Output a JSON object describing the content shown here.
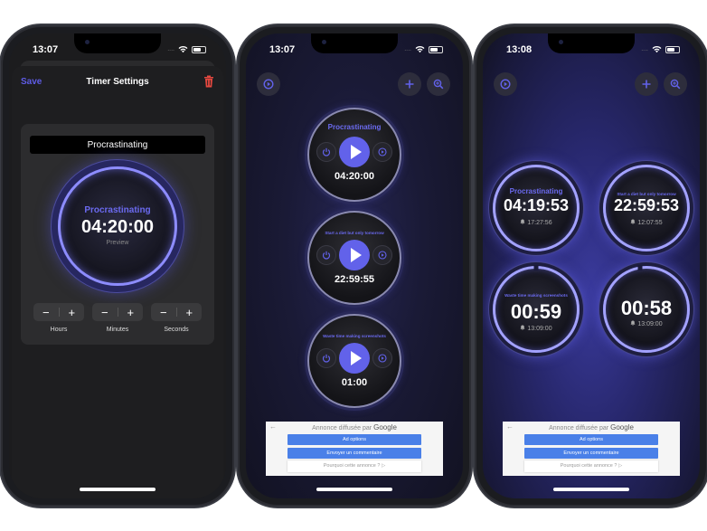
{
  "phones": [
    {
      "status": {
        "time": "13:07",
        "signal": "....",
        "icons": [
          "wifi-icon",
          "battery-icon"
        ]
      },
      "header": {
        "save_label": "Save",
        "title": "Timer Settings",
        "delete_icon": "trash-icon"
      },
      "name_field": {
        "value": "Procrastinating"
      },
      "preview": {
        "label": "Procrastinating",
        "time": "04:20:00",
        "caption": "Preview"
      },
      "steppers": [
        {
          "label": "Hours",
          "minus": "−",
          "plus": "+"
        },
        {
          "label": "Minutes",
          "minus": "−",
          "plus": "+"
        },
        {
          "label": "Seconds",
          "minus": "−",
          "plus": "+"
        }
      ]
    },
    {
      "status": {
        "time": "13:07",
        "signal": "....",
        "icons": [
          "wifi-icon",
          "battery-icon"
        ]
      },
      "toolbar": {
        "left_icon": "play-circle-icon",
        "add_icon": "plus-icon",
        "zoom_icon": "zoom-in-icon"
      },
      "timers": [
        {
          "label": "Procrastinating",
          "time": "04:20:00"
        },
        {
          "label": "Start a diet but only tomorrow",
          "time": "22:59:55"
        },
        {
          "label": "Waste time making screenshots",
          "time": "01:00"
        }
      ],
      "ad": {
        "back": "←",
        "heading": "Annonce diffusée par",
        "brand": "Google",
        "options": "Ad options",
        "feedback": "Envoyer un commentaire",
        "why": "Pourquoi cette annonce ? ▷"
      }
    },
    {
      "status": {
        "time": "13:08",
        "signal": "....",
        "icons": [
          "wifi-icon",
          "battery-icon"
        ]
      },
      "toolbar": {
        "left_icon": "play-circle-icon",
        "add_icon": "plus-icon",
        "zoom_icon": "zoom-in-icon"
      },
      "running": [
        {
          "label": "Procrastinating",
          "time": "04:19:53",
          "alarm": "17:27:56"
        },
        {
          "label": "Start a diet but only tomorrow",
          "time": "22:59:53",
          "alarm": "12:07:55"
        },
        {
          "label": "Waste time making screenshots",
          "time": "00:59",
          "alarm": "13:09:00"
        },
        {
          "label": "",
          "time": "00:58",
          "alarm": "13:09:00"
        }
      ],
      "ad": {
        "back": "←",
        "heading": "Annonce diffusée par",
        "brand": "Google",
        "options": "Ad options",
        "feedback": "Envoyer un commentaire",
        "why": "Pourquoi cette annonce ? ▷"
      }
    }
  ],
  "colors": {
    "accent": "#5e5ce6",
    "delete": "#e5483f",
    "ad_button": "#4a80e8"
  }
}
